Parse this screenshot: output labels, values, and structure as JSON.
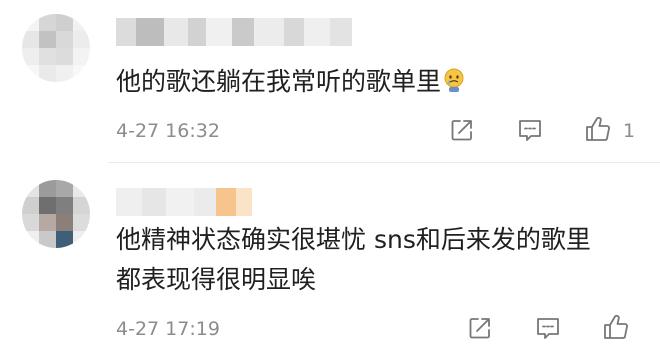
{
  "comments": [
    {
      "text_lines": [
        "他的歌还躺在我常听的歌单里"
      ],
      "emoji_icon": "crying-face-icon",
      "timestamp": "4-27 16:32",
      "like_count": "1"
    },
    {
      "text_lines": [
        "他精神状态确实很堪忧 sns和后来发的歌里",
        "都表现得很明显唉"
      ],
      "timestamp": "4-27 17:19",
      "like_count": ""
    }
  ],
  "colors": {
    "text": "#202020",
    "meta": "#8c8c8c",
    "divider": "#e9e9e9"
  }
}
